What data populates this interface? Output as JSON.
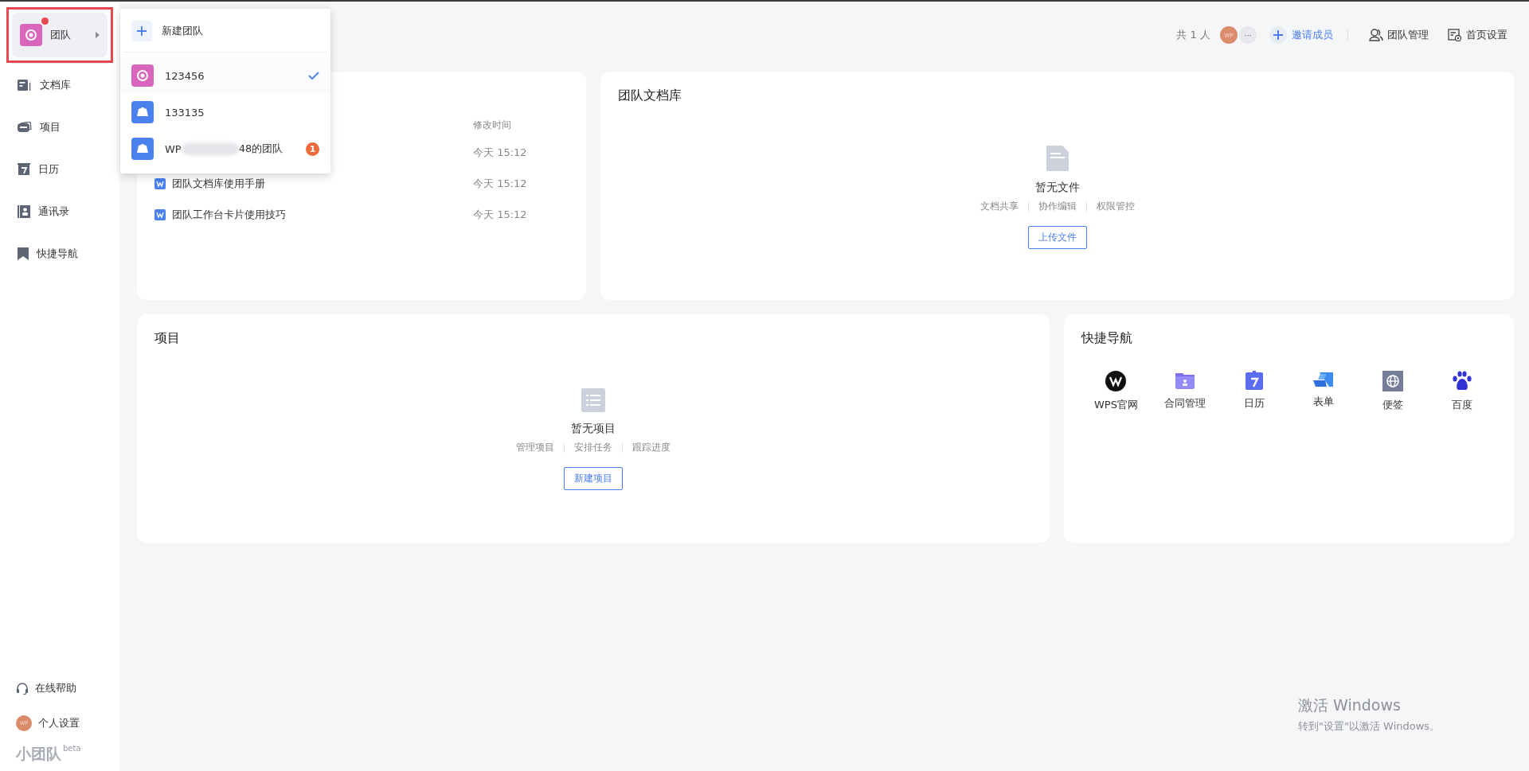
{
  "sidebar": {
    "team_switcher": {
      "label": "团队",
      "highlighted": true,
      "notification_dot": true
    },
    "items": [
      {
        "kind": "docs",
        "label": "文档库"
      },
      {
        "kind": "project",
        "label": "项目"
      },
      {
        "kind": "calendar",
        "label": "日历"
      },
      {
        "kind": "contacts",
        "label": "通讯录"
      },
      {
        "kind": "bookmark",
        "label": "快捷导航"
      }
    ],
    "bottom_items": [
      {
        "kind": "help",
        "label": "在线帮助"
      },
      {
        "kind": "avatar",
        "avatar": "WP",
        "label": "个人设置"
      }
    ],
    "brand": {
      "name": "小团队",
      "tag": "beta"
    }
  },
  "team_menu": {
    "new_team": "新建团队",
    "teams": [
      {
        "kind": "ring",
        "name": "123456",
        "selected": true
      },
      {
        "kind": "people",
        "name": "133135",
        "selected": false
      },
      {
        "kind": "people",
        "name": "WP",
        "name_end": "48的团队",
        "redacted": true,
        "selected": false,
        "badge": "1"
      }
    ]
  },
  "header": {
    "member_count": "共 1 人",
    "avatar": "WP",
    "more": "···",
    "invite": "邀请成员",
    "team_manage": "团队管理",
    "home_settings": "首页设置"
  },
  "recent_docs": {
    "column": "修改时间",
    "rows": [
      {
        "time": "今天 15:12"
      },
      {
        "name": "团队文档库使用手册",
        "time": "今天 15:12"
      },
      {
        "name": "团队工作台卡片使用技巧",
        "time": "今天 15:12"
      }
    ]
  },
  "team_library": {
    "title": "团队文档库",
    "empty": {
      "kind": "file",
      "text": "暂无文件",
      "features": [
        "文档共享",
        "协作编辑",
        "权限管控"
      ],
      "button": "上传文件"
    }
  },
  "projects": {
    "title": "项目",
    "empty": {
      "kind": "list",
      "text": "暂无项目",
      "features": [
        "管理项目",
        "安排任务",
        "跟踪进度"
      ],
      "button": "新建项目"
    }
  },
  "quick_nav": {
    "title": "快捷导航",
    "items": [
      {
        "kind": "wps",
        "label": "WPS官网"
      },
      {
        "kind": "contract",
        "label": "合同管理"
      },
      {
        "kind": "calendar",
        "label": "日历"
      },
      {
        "kind": "form",
        "label": "表单"
      },
      {
        "kind": "globe",
        "label": "便签"
      },
      {
        "kind": "paw",
        "label": "百度"
      }
    ]
  },
  "os_notice": {
    "title": "激活 Windows",
    "text": "转到\"设置\"以激活 Windows。"
  }
}
